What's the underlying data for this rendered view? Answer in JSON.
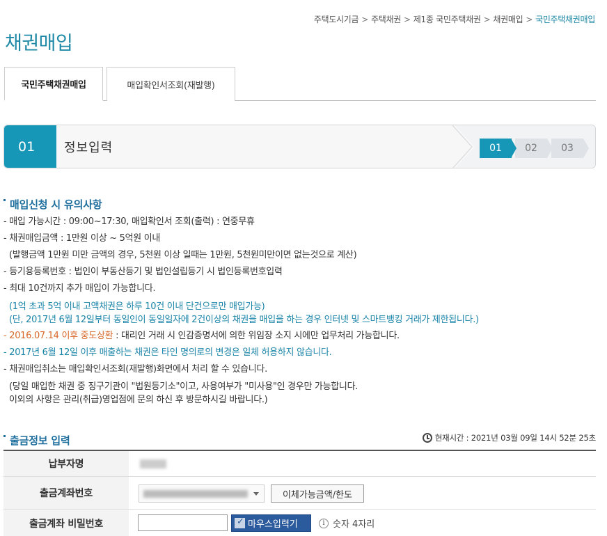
{
  "breadcrumb": {
    "items": [
      "주택도시기금",
      "주택채권",
      "제1종 국민주택채권",
      "채권매입"
    ],
    "current": "국민주택채권매입",
    "separator": ">"
  },
  "page_title": "채권매입",
  "tabs": [
    {
      "label": "국민주택채권매입",
      "active": true
    },
    {
      "label": "매입확인서조회(재발행)",
      "active": false
    }
  ],
  "step": {
    "current_number": "01",
    "current_title": "정보입력",
    "steps": [
      "01",
      "02",
      "03"
    ]
  },
  "notice": {
    "heading": "매입신청 시 유의사항",
    "lines": [
      "- 매입 가능시간 : 09:00~17:30, 매입확인서 조회(출력) : 연중무휴",
      "- 채권매입금액 : 1만원 이상 ~ 5억원 이내",
      "(발행금액 1만원 미만 금액의 경우, 5천원 이상 일때는 1만원, 5천원미만이면 없는것으로 계산)",
      "- 등기용등록번호 : 법인이 부동산등기 및 법인설립등기 시 법인등록번호입력",
      "- 최대 10건까지 추가 매입이 가능합니다.",
      "(1억 초과 5억 이내 고액채권은 하루 10건 이내 단건으로만 매입가능)",
      "(단, 2017년 6월 12일부터 동일인이 동일일자에 2건이상의 채권을 매입을 하는 경우 인터넷 및 스마트뱅킹 거래가 제한됩니다.)",
      "- 2016.07.14 이후 중도상환",
      " : 대리인 거래 시 인감증명서에 의한 위임장 소지 시에만 업무처리 가능합니다.",
      "- 2017년 6월 12일 이후 매출하는 채권은 타인 명의로의 변경은 일체 허용하지 않습니다.",
      "- 채권매입취소는 매입확인서조회(재발행)화면에서 처리 할 수 있습니다.",
      "(당일 매입한 채권 중 징구기관이 \"법원등기소\"이고, 사용여부가 \"미사용\"인 경우만 가능합니다.",
      "이외의 사항은 관리(취급)영업점에 문의 하신 후 방문하시길 바랍니다.)"
    ]
  },
  "withdrawal": {
    "heading": "출금정보 입력",
    "time_label": "현재시간 : 2021년 03월 09일 14시 52분 25초",
    "rows": {
      "payer_label": "납부자명",
      "account_label": "출금계좌번호",
      "limit_button": "이체가능금액/한도",
      "password_label": "출금계좌 비밀번호",
      "mouse_input_label": "마우스입력기",
      "password_hint": "숫자 4자리"
    }
  },
  "colors": {
    "accent": "#1797b8",
    "title": "#1f8aa7",
    "heading": "#1f6f9e",
    "highlight_blue": "#1a84a8",
    "highlight_orange": "#d8682a",
    "button_blue": "#2b5a9d"
  },
  "icons": [
    "clock-icon",
    "info-icon",
    "checkbox-icon",
    "caret-down-icon"
  ]
}
